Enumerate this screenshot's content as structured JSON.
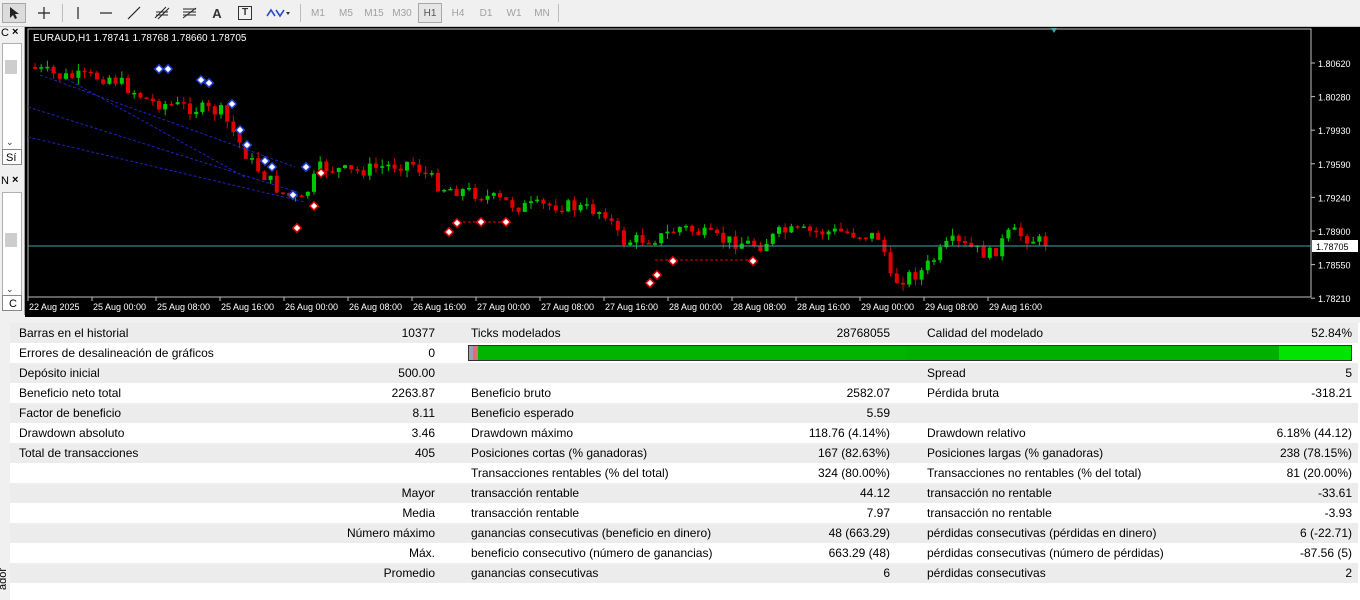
{
  "toolbar": {
    "timeframes": [
      "M1",
      "M5",
      "M15",
      "M30",
      "H1",
      "H4",
      "D1",
      "W1",
      "MN"
    ],
    "active_timeframe": "H1",
    "text_tool_label": "A",
    "text_label_tool_label": "T"
  },
  "left_panel": {
    "tab1_label": "C",
    "tab1_close": "×",
    "tab1_item": "Sí",
    "tab2_label": "N",
    "tab2_close": "×",
    "tab2_item": "C"
  },
  "chart": {
    "symbol_info": "EURAUD,H1  1.78741 1.78768 1.78660 1.78705",
    "current_price": "1.78705",
    "colors": {
      "bull": "#00c800",
      "bear": "#e00000",
      "price_line": "#3fa9a9",
      "grid_text": "#ffffff",
      "trend": "#2020c0"
    },
    "price_labels": [
      "1.80620",
      "1.80280",
      "1.79930",
      "1.79590",
      "1.79240",
      "1.78900",
      "1.78550",
      "1.78210"
    ],
    "time_labels": [
      "22 Aug 2025",
      "25 Aug 00:00",
      "25 Aug 08:00",
      "25 Aug 16:00",
      "26 Aug 00:00",
      "26 Aug 08:00",
      "26 Aug 16:00",
      "27 Aug 00:00",
      "27 Aug 08:00",
      "27 Aug 16:00",
      "28 Aug 00:00",
      "28 Aug 08:00",
      "28 Aug 16:00",
      "29 Aug 00:00",
      "29 Aug 08:00",
      "29 Aug 16:00"
    ]
  },
  "report": {
    "rows": [
      [
        "Barras en el historial",
        "10377",
        "Ticks modelados",
        "28768055",
        "Calidad del modelado",
        "52.84%"
      ],
      [
        "Errores de desalineación de gráficos",
        "0",
        "",
        "",
        "",
        ""
      ],
      [
        "Depósito inicial",
        "500.00",
        "",
        "",
        "Spread",
        "5"
      ],
      [
        "Beneficio neto total",
        "2263.87",
        "Beneficio bruto",
        "2582.07",
        "Pérdida bruta",
        "-318.21"
      ],
      [
        "Factor de beneficio",
        "8.11",
        "Beneficio esperado",
        "5.59",
        "",
        ""
      ],
      [
        "Drawdown absoluto",
        "3.46",
        "Drawdown máximo",
        "118.76 (4.14%)",
        "Drawdown relativo",
        "6.18% (44.12)"
      ],
      [
        "Total de transacciones",
        "405",
        "Posiciones cortas (% ganadoras)",
        "167 (82.63%)",
        "Posiciones largas (% ganadoras)",
        "238 (78.15%)"
      ],
      [
        "",
        "",
        "Transacciones rentables (% del total)",
        "324 (80.00%)",
        "Transacciones no rentables (% del total)",
        "81 (20.00%)"
      ],
      [
        "",
        "Mayor",
        "transacción rentable",
        "44.12",
        "transacción no rentable",
        "-33.61"
      ],
      [
        "",
        "Media",
        "transacción rentable",
        "7.97",
        "transacción no rentable",
        "-3.93"
      ],
      [
        "",
        "Número máximo",
        "ganancias consecutivas (beneficio en dinero)",
        "48 (663.29)",
        "pérdidas consecutivas (pérdidas en dinero)",
        "6 (-22.71)"
      ],
      [
        "",
        "Máx.",
        "beneficio consecutivo (número de ganancias)",
        "663.29 (48)",
        "pérdidas consecutivas (número de pérdidas)",
        "-87.56 (5)"
      ],
      [
        "",
        "Promedio",
        "ganancias consecutivas",
        "6",
        "pérdidas consecutivas",
        "2"
      ]
    ]
  },
  "side_tab_label": "ador"
}
